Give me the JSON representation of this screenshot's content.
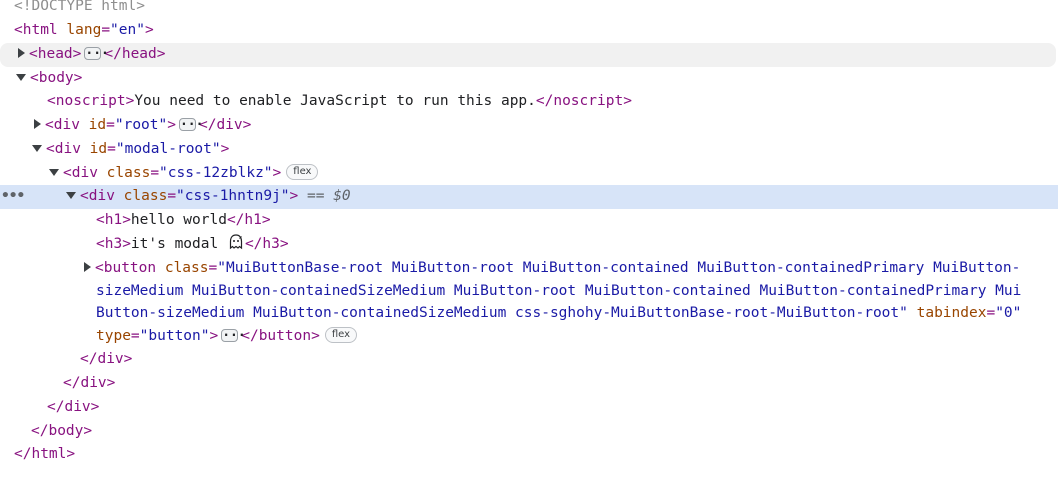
{
  "lines": {
    "doctype": "<!DOCTYPE html>",
    "html_open_tag": "<html",
    "html_lang_attr": "lang",
    "html_lang_val": "\"en\"",
    "html_open_close": ">",
    "head_open": "<head>",
    "head_close": "</head>",
    "body_open": "<body>",
    "noscript_open": "<noscript>",
    "noscript_text": "You need to enable JavaScript to run this app.",
    "noscript_close": "</noscript>",
    "root_tag": "<div",
    "root_attr": "id",
    "root_val": "\"root\"",
    "root_gt": ">",
    "root_close": "</div>",
    "modal_tag": "<div",
    "modal_attr": "id",
    "modal_val": "\"modal-root\"",
    "modal_gt": ">",
    "css12_tag": "<div",
    "css12_attr": "class",
    "css12_val": "\"css-12zblkz\"",
    "css12_gt": ">",
    "css12_badge": "flex",
    "sel_tag": "<div",
    "sel_attr": "class",
    "sel_val": "\"css-1hntn9j\"",
    "sel_gt": ">",
    "sel_eq": "== $0",
    "h1_open": "<h1>",
    "h1_text": "hello world",
    "h1_close": "</h1>",
    "h3_open": "<h3>",
    "h3_text": "it's modal ",
    "h3_close": "</h3>",
    "btn_tag": "<button",
    "btn_class_attr": "class",
    "btn_class_val_1": "\"MuiButtonBase-root MuiButton-root MuiButton-contained MuiButton-containedPrimary MuiButton-",
    "btn_class_val_2": "sizeMedium MuiButton-containedSizeMedium MuiButton-root MuiButton-contained MuiButton-containedPrimary Mui",
    "btn_class_val_3": "Button-sizeMedium MuiButton-containedSizeMedium css-sghohy-MuiButtonBase-root-MuiButton-root\"",
    "btn_tabindex_attr": "tabindex",
    "btn_tabindex_val": "\"0\"",
    "btn_type_attr": "type",
    "btn_type_val": "\"button\"",
    "btn_gt": ">",
    "btn_close": "</button>",
    "btn_badge": "flex",
    "div_close": "</div>",
    "body_close": "</body>",
    "html_close": "</html>",
    "gutter_dots": "•••"
  },
  "colors": {
    "tag": "#881280",
    "attr": "#994500",
    "value": "#1a1aa6",
    "selected_bg": "#d7e4f8",
    "hover_bg": "#f1f1f1"
  }
}
